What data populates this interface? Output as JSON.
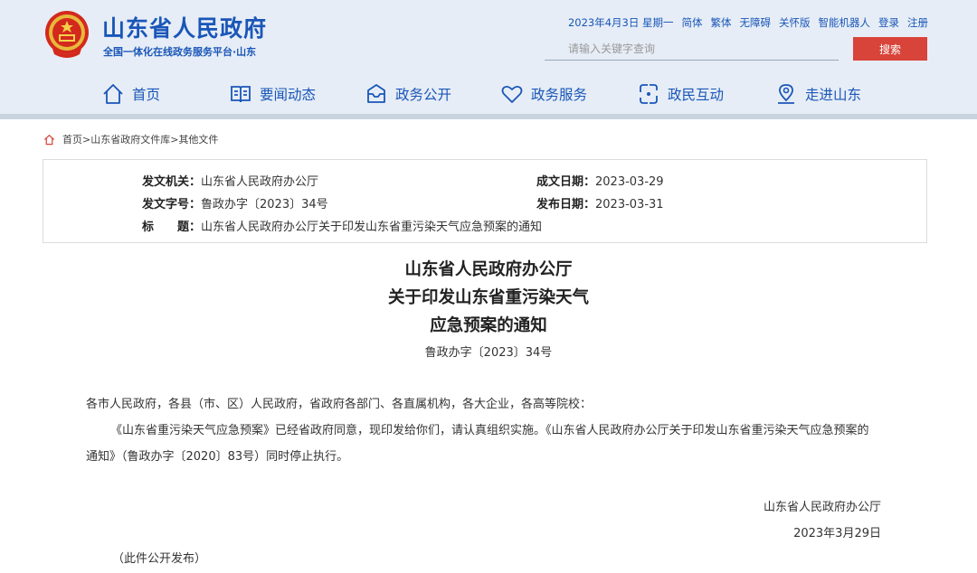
{
  "header": {
    "site_title": "山东省人民政府",
    "site_subtitle": "全国一体化在线政务服务平台·山东",
    "date": "2023年4月3日 星期一",
    "links": [
      "简体",
      "繁体",
      "无障碍",
      "关怀版",
      "智能机器人",
      "登录",
      "注册"
    ],
    "search_placeholder": "请输入关键字查询",
    "search_button": "搜索",
    "brand_color": "#1a56b8",
    "accent_color": "#d8433a"
  },
  "nav": [
    {
      "label": "首页",
      "icon": "home-icon"
    },
    {
      "label": "要闻动态",
      "icon": "book-icon"
    },
    {
      "label": "政务公开",
      "icon": "inbox-icon"
    },
    {
      "label": "政务服务",
      "icon": "heart-icon"
    },
    {
      "label": "政民互动",
      "icon": "interaction-icon"
    },
    {
      "label": "走进山东",
      "icon": "location-icon"
    }
  ],
  "breadcrumb": {
    "items": [
      "首页",
      "山东省政府文件库",
      "其他文件"
    ],
    "separator": ">"
  },
  "meta": {
    "issuer_label": "发文机关：",
    "issuer": "山东省人民政府办公厅",
    "doc_no_label": "发文字号：",
    "doc_no": "鲁政办字〔2023〕34号",
    "title_label": "标　　题：",
    "title": "山东省人民政府办公厅关于印发山东省重污染天气应急预案的通知",
    "created_label": "成文日期：",
    "created": "2023-03-29",
    "published_label": "发布日期：",
    "published": "2023-03-31"
  },
  "document": {
    "title_lines": [
      "山东省人民政府办公厅",
      "关于印发山东省重污染天气",
      "应急预案的通知"
    ],
    "doc_no": "鲁政办字〔2023〕34号",
    "salutation": "各市人民政府，各县（市、区）人民政府，省政府各部门、各直属机构，各大企业，各高等院校：",
    "paragraph_line1": "《山东省重污染天气应急预案》已经省政府同意，现印发给你们，请认真组织实施。《山东省人民政府办公厅关于印发山东省重污染天气应急预案的",
    "paragraph_line2": "通知》（鲁政办字〔2020〕83号）同时停止执行。",
    "signature": "山东省人民政府办公厅",
    "sign_date": "2023年3月29日",
    "note": "（此件公开发布）"
  }
}
